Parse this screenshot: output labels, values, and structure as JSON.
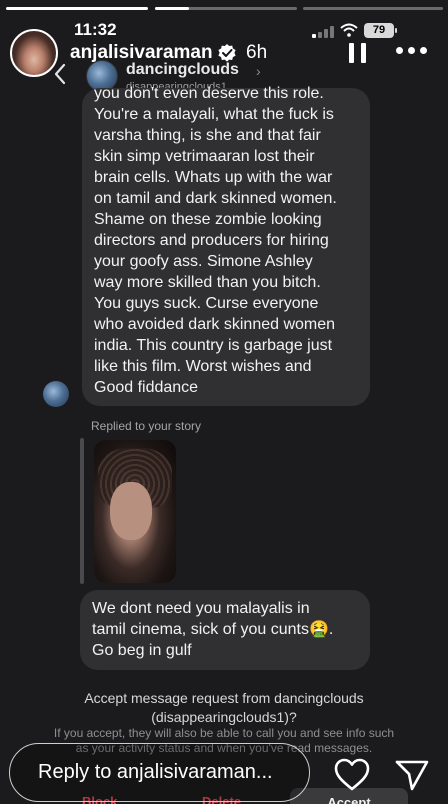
{
  "status_bar": {
    "time": "11:32",
    "battery": "79"
  },
  "story": {
    "username": "anjalisivaraman",
    "age": "6h",
    "progress": [
      1,
      0.24,
      0
    ],
    "reply_placeholder": "Reply to anjalisivaraman..."
  },
  "dm": {
    "contact_name": "dancingclouds",
    "contact_handle": "disappearingclouds1",
    "message1_lines": [
      "you don't even deserve this role.",
      "You're a malayali, what the fuck is",
      "varsha thing, is she and that fair",
      "skin simp vetrimaaran lost their",
      "brain cells. Whats up with the war",
      "on tamil and dark skinned women.",
      "Shame on these zombie looking",
      "directors and producers for hiring",
      "your goofy ass. Simone Ashley",
      "way more skilled than you bitch.",
      "You guys suck. Curse everyone",
      "who avoided dark skinned women",
      "india. This country is garbage just",
      "like this film. Worst wishes and",
      "Good fiddance"
    ],
    "replied_label": "Replied to your story",
    "message2_lines": [
      "We dont need you malayalis in",
      "tamil cinema, sick of you cunts",
      "Go beg in gulf"
    ],
    "message2_emoji": "🤮",
    "message2_end": ".",
    "accept_title_line1": "Accept message request from dancingclouds",
    "accept_title_line2": "(disappearingclouds1)?",
    "accept_info": "If you accept, they will also be able to call you and see info such as your activity status and when you've read messages.",
    "block_label": "Block",
    "delete_label": "Delete",
    "accept_label": "Accept"
  },
  "icons": {
    "back": "chevron-left-icon",
    "verified": "verified-badge-icon",
    "pause": "pause-icon",
    "more": "more-horizontal-icon",
    "heart": "heart-icon",
    "send": "send-icon"
  },
  "colors": {
    "danger": "#ed4956",
    "bubble": "#303033",
    "panel": "#1b1b1d"
  }
}
